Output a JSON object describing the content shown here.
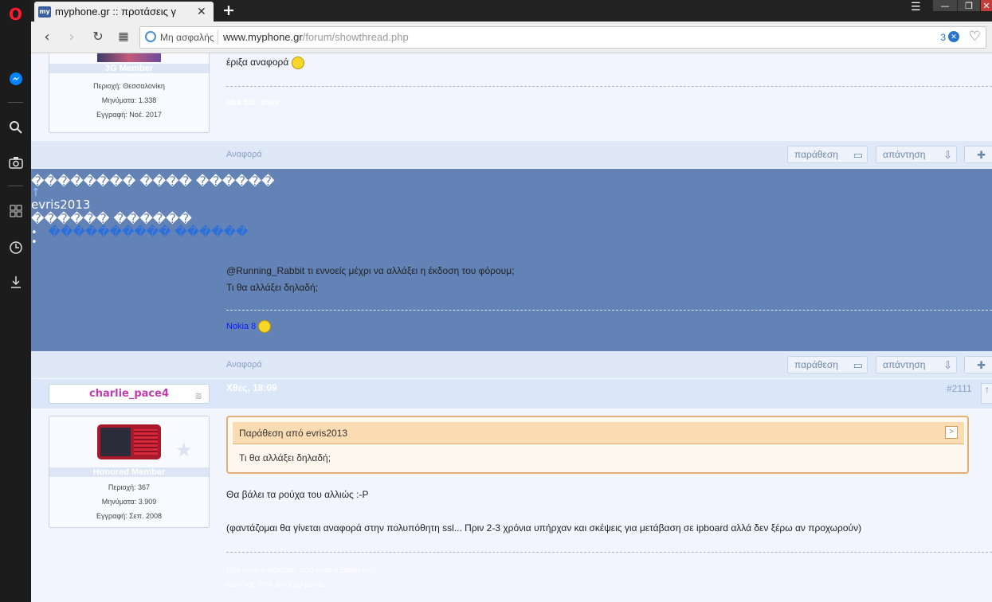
{
  "browser": {
    "tab_title": "myphone.gr :: προτάσεις γ",
    "tab_favicon": "my",
    "security_label": "Μη ασφαλής",
    "url_host": "www.myphone.gr",
    "url_path": "/forum/showthread.php",
    "adblock_count": "3"
  },
  "post1": {
    "role": "3G Member",
    "region": "Περιοχή: Θεσσαλονίκη",
    "messages": "Μηνύματα: 1.338",
    "joined": "Εγγραφή: Νοέ. 2017",
    "text": "έριξα αναφορά",
    "signature": "aka bill_thes",
    "report": "Αναφορά",
    "quote_btn": "παράθεση",
    "reply_btn": "απάντηση"
  },
  "post2": {
    "garbled_1": "�������� ���� ������",
    "arrow": "↑",
    "username": "evris2013",
    "garbled_2": "������ ������",
    "garbled_link": "���������� ������",
    "bullet": "•",
    "line1": "@Running_Rabbit τι εννοείς μέχρι να αλλάξει η έκδοση του φόρουμ;",
    "line2": "Τι θα αλλάξει δηλαδή;",
    "signature": "Nokia 8",
    "report": "Αναφορά",
    "quote_btn": "παράθεση",
    "reply_btn": "απάντηση"
  },
  "post3": {
    "username": "charlie_pace4",
    "date": "Χθες, 18:09",
    "number": "#2111",
    "role": "Honored Member",
    "region": "Περιοχή: 367",
    "messages": "Μηνύματα: 3.909",
    "joined": "Εγγραφή: Σεπ. 2008",
    "quote_header": "Παράθεση από evris2013",
    "quote_body": "Τι θα αλλάξει δηλαδή;",
    "line1": "Θα βάλει τα ρούχα του αλλιώς :-P",
    "line2": "(φαντάζομαι θα γίνεται αναφορά στην πολυπόθητη ssl... Πριν 2-3 χρόνια υπήρχαν και σκέψεις για μετάβαση σε ipboard αλλά δεν ξέρω αν προχωρούν)",
    "sig1": "Πού είναι ο Κάιστας, πού είναι ο Βαλεντίνο,",
    "sig2": "Κανένας από δεν έχω μείνει..."
  }
}
